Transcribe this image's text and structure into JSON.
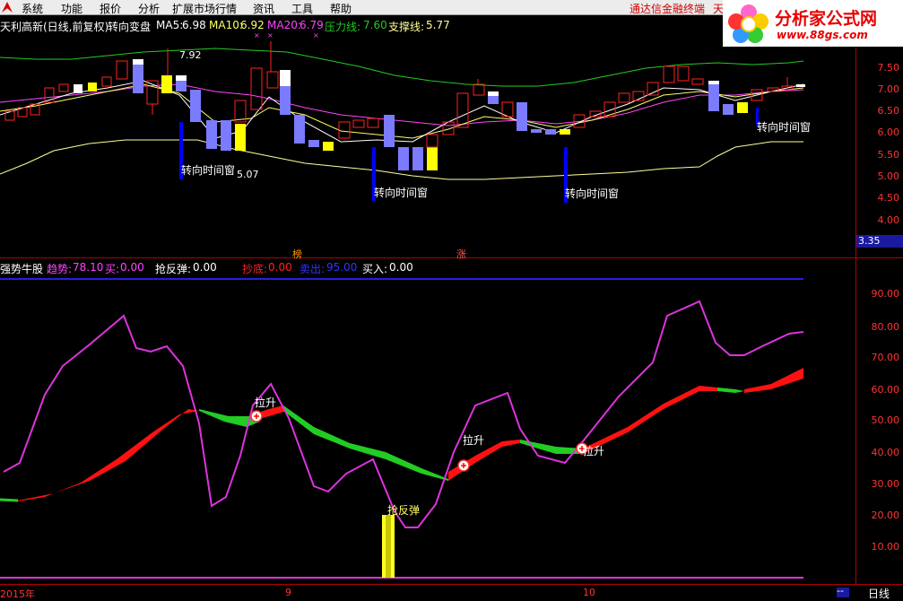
{
  "menubar": {
    "items": [
      "系统",
      "功能",
      "报价",
      "分析",
      "扩展市场行情",
      "资讯",
      "工具",
      "帮助"
    ],
    "promo": "通达信金融终端",
    "promo2": "天"
  },
  "logo": {
    "title": "分析家公式网",
    "url_text": "www.88gs.com"
  },
  "main_header": {
    "stock": "天利高新(日线,前复权)",
    "indicator": "转向变盘",
    "ma5_label": "MA5:",
    "ma5_value": "6.98",
    "ma10_label": "MA10:",
    "ma10_value": "6.92",
    "ma20_label": "MA20:",
    "ma20_value": "6.79",
    "pressure_label": "压力线:",
    "pressure_value": "7.60",
    "support_label": "支撑线:",
    "support_value": "5.77"
  },
  "price_axis": [
    "7.50",
    "7.00",
    "6.50",
    "6.00",
    "5.50",
    "5.00",
    "4.50",
    "4.00"
  ],
  "current_price": "3.35",
  "annotations": {
    "high_label": "7.92",
    "low_label": "5.07",
    "turn_window": "转向时间窗",
    "marker_a": "榜",
    "marker_b": "涨"
  },
  "sub_header": {
    "name": "强势牛股",
    "trend_label": "趋势:",
    "trend_value": "78.10",
    "buy_label": "买:",
    "buy_value": "0.00",
    "rebound_label": "抢反弹:",
    "rebound_value": "0.00",
    "bottom_label": "抄底:",
    "bottom_value": "0.00",
    "sell_label": "卖出:",
    "sell_value": "95.00",
    "buyin_label": "买入:",
    "buyin_value": "0.00"
  },
  "sub_axis": [
    "90.00",
    "80.00",
    "70.00",
    "60.00",
    "50.00",
    "40.00",
    "30.00",
    "20.00",
    "10.00"
  ],
  "sub_annotations": {
    "lift": "拉升",
    "rebound": "抢反弹"
  },
  "date_axis": {
    "year": "2015年",
    "m9": "9",
    "m10": "10"
  },
  "period": "日线",
  "scroll_dash": "--",
  "colors": {
    "up": "#ff2222",
    "down": "#7b7bff",
    "ma5": "#ffffff",
    "ma10": "#ffff66",
    "ma20": "#ff44ff",
    "pressure": "#22cc22",
    "support": "#ffff99",
    "trend": "#dd33dd"
  }
}
